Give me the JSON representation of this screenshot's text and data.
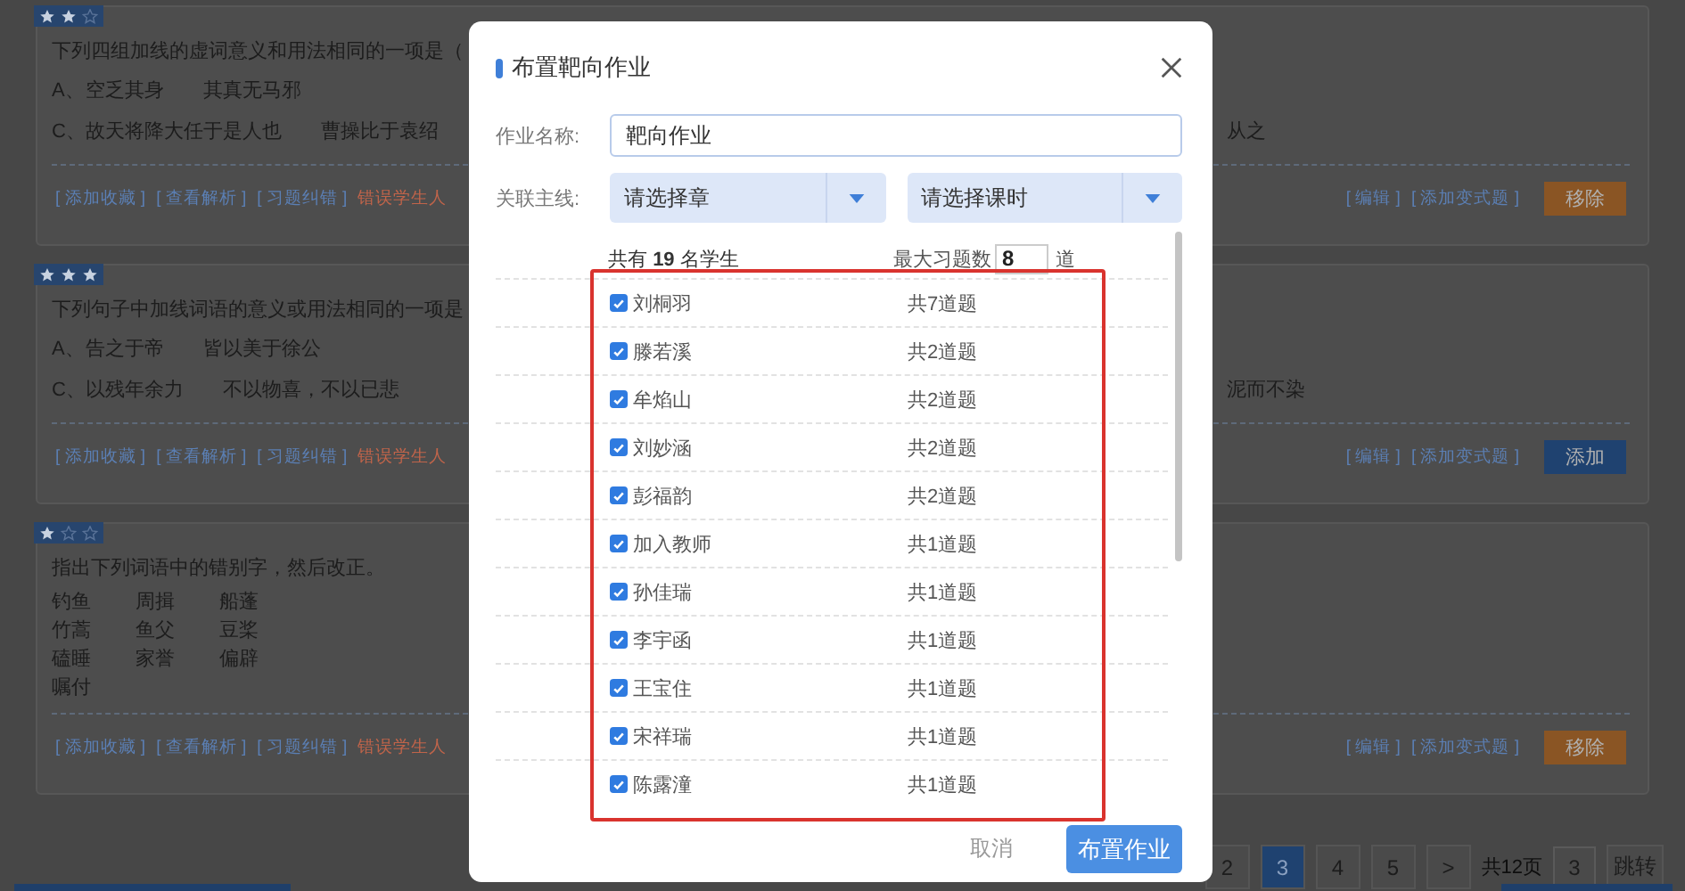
{
  "questions": [
    {
      "stars": 2,
      "text": "下列四组加线的虚词意义和用法相同的一项是（",
      "options": [
        {
          "letter": "A、",
          "parts": [
            "空乏其身",
            "其真无马邪"
          ]
        },
        {
          "letter": "C、",
          "parts": [
            "故天将降大任于是人也",
            "曹操比于袁绍"
          ],
          "fragment": "从之"
        }
      ],
      "links": [
        "[ 添加收藏 ]",
        "[ 查看解析 ]",
        "[ 习题纠错 ]"
      ],
      "error_count": "错误学生人",
      "edit_links": [
        "[ 编辑 ]",
        "[ 添加变式题 ]"
      ],
      "action": {
        "label": "移除",
        "kind": "remove"
      }
    },
    {
      "stars": 3,
      "text": "下列句子中加线词语的意义或用法相同的一项是",
      "options": [
        {
          "letter": "A、",
          "parts": [
            "告之于帝",
            "皆以美于徐公"
          ]
        },
        {
          "letter": "C、",
          "parts": [
            "以残年余力",
            "不以物喜，不以已悲"
          ],
          "fragment": "泥而不染"
        }
      ],
      "links": [
        "[ 添加收藏 ]",
        "[ 查看解析 ]",
        "[ 习题纠错 ]"
      ],
      "error_count": "错误学生人",
      "edit_links": [
        "[ 编辑 ]",
        "[ 添加变式题 ]"
      ],
      "action": {
        "label": "添加",
        "kind": "add"
      }
    },
    {
      "stars": 1,
      "text": "指出下列词语中的错别字，然后改正。",
      "words": [
        [
          "钓鱼",
          "周揖",
          "船蓬"
        ],
        [
          "竹蒿",
          "鱼父",
          "豆桨"
        ],
        [
          "磕睡",
          "家誉",
          "偏辟"
        ],
        [
          "嘱付"
        ]
      ],
      "links": [
        "[ 添加收藏 ]",
        "[ 查看解析 ]",
        "[ 习题纠错 ]"
      ],
      "error_count": "错误学生人",
      "edit_links": [
        "[ 编辑 ]",
        "[ 添加变式题 ]"
      ],
      "action": {
        "label": "移除",
        "kind": "remove"
      }
    }
  ],
  "pagination": {
    "pages": [
      {
        "label": "2",
        "selected": false
      },
      {
        "label": "3",
        "selected": true
      },
      {
        "label": "4",
        "selected": false
      },
      {
        "label": "5",
        "selected": false
      }
    ],
    "next": ">",
    "total": "共12页",
    "jump_value": "3",
    "jump_button": "跳转"
  },
  "dialog": {
    "title": "布置靶向作业",
    "name_label": "作业名称:",
    "name_value": "靶向作业",
    "line_label": "关联主线:",
    "selects": [
      {
        "placeholder": "请选择章"
      },
      {
        "placeholder": "请选择课时"
      }
    ],
    "summary": "共有 **19** 名学生",
    "max_label": "最大习题数",
    "max_value": "8",
    "max_unit": "道",
    "students": [
      {
        "name": "刘桐羽",
        "checked": true,
        "count": "共7道题"
      },
      {
        "name": "滕若溪",
        "checked": true,
        "count": "共2道题"
      },
      {
        "name": "牟焰山",
        "checked": true,
        "count": "共2道题"
      },
      {
        "name": "刘妙涵",
        "checked": true,
        "count": "共2道题"
      },
      {
        "name": "彭福韵",
        "checked": true,
        "count": "共2道题"
      },
      {
        "name": "加入教师",
        "checked": true,
        "count": "共1道题"
      },
      {
        "name": "孙佳瑞",
        "checked": true,
        "count": "共1道题"
      },
      {
        "name": "李宇函",
        "checked": true,
        "count": "共1道题"
      },
      {
        "name": "王宝住",
        "checked": true,
        "count": "共1道题"
      },
      {
        "name": "宋祥瑞",
        "checked": true,
        "count": "共1道题"
      },
      {
        "name": "陈露潼",
        "checked": true,
        "count": "共1道题"
      }
    ],
    "cancel": "取消",
    "submit": "布置作业"
  }
}
